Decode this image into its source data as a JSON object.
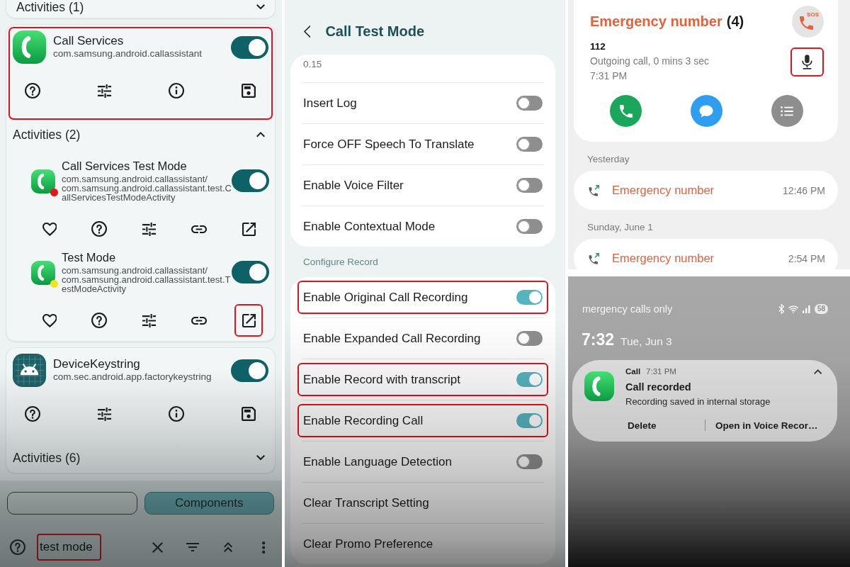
{
  "app_list": {
    "top_group": {
      "label": "Activities (1)",
      "expanded": false
    },
    "apps": [
      {
        "kind": "phone",
        "name": "Call Services",
        "package": "com.samsung.android.callassistant",
        "enabled": true,
        "highlighted": true,
        "activities": {
          "label": "Activities (2)",
          "expanded": true,
          "items": [
            {
              "name": "Call Services Test Mode",
              "package": "com.samsung.android.callassistant/",
              "activity": "com.samsung.android.callassistant.test.CallServicesTestModeActivity",
              "enabled": true,
              "color": "#e8141b",
              "launch_highlighted": false
            },
            {
              "name": "Test Mode",
              "package": "com.samsung.android.callassistant/",
              "activity": "com.samsung.android.callassistant.test.TestModeActivity",
              "enabled": true,
              "color": "#f2e418",
              "launch_highlighted": true
            }
          ]
        }
      },
      {
        "kind": "android",
        "name": "DeviceKeystring",
        "package": "com.sec.android.app.factorykeystring",
        "enabled": true,
        "highlighted": false,
        "activities": {
          "label": "Activities (6)",
          "expanded": false
        }
      }
    ],
    "chips": [
      {
        "selected": false
      },
      {
        "label": "Components",
        "selected": true
      }
    ],
    "search": {
      "value": "test mode",
      "highlighted": true
    }
  },
  "settings": {
    "title": "Call Test Mode",
    "groups": [
      {
        "rows": [
          {
            "kind": "summary",
            "text": "0.15",
            "highlighted": false
          },
          {
            "kind": "switch",
            "label": "Insert Log",
            "on": false,
            "highlighted": false
          },
          {
            "kind": "switch",
            "label": "Force OFF Speech To Translate",
            "on": false,
            "highlighted": false
          },
          {
            "kind": "switch",
            "label": "Enable Voice Filter",
            "on": false,
            "highlighted": false
          },
          {
            "kind": "switch",
            "label": "Enable Contextual Mode",
            "on": false,
            "highlighted": false
          }
        ]
      },
      {
        "header": "Configure Record",
        "rows": [
          {
            "kind": "switch",
            "label": "Enable Original Call Recording",
            "on": true,
            "highlighted": true
          },
          {
            "kind": "switch",
            "label": "Enable Expanded Call Recording",
            "on": false,
            "highlighted": false
          },
          {
            "kind": "switch",
            "label": "Enable Record with transcript",
            "on": true,
            "highlighted": true
          },
          {
            "kind": "switch",
            "label": "Enable Recording Call",
            "on": true,
            "highlighted": true
          },
          {
            "kind": "switch",
            "label": "Enable Language Detection",
            "on": false,
            "highlighted": false
          },
          {
            "kind": "action",
            "label": "Clear Transcript Setting",
            "highlighted": false
          },
          {
            "kind": "action",
            "label": "Clear Promo Preference",
            "highlighted": false
          }
        ]
      }
    ]
  },
  "call_log": {
    "contact": {
      "name": "Emergency number",
      "count": "(4)",
      "avatar_label": "SOS"
    },
    "latest": {
      "number": "112",
      "detail": "Outgoing call, 0 mins 3 sec",
      "time": "7:31 PM",
      "recording_highlighted": true
    },
    "history": [
      {
        "date": "Yesterday",
        "entries": [
          {
            "name": "Emergency number",
            "time": "12:46 PM"
          }
        ]
      },
      {
        "date": "Sunday, June 1",
        "entries": [
          {
            "name": "Emergency number",
            "time": "2:54 PM"
          }
        ]
      }
    ]
  },
  "lock_screen": {
    "carrier": "mergency calls only",
    "battery": "58",
    "clock": "7:32",
    "date": "Tue, Jun 3",
    "notification": {
      "app": "Call",
      "time": "7:31 PM",
      "title": "Call recorded",
      "text": "Recording saved in internal storage",
      "expanded": true,
      "actions": [
        "Delete",
        "Open in Voice Recor…"
      ]
    }
  }
}
